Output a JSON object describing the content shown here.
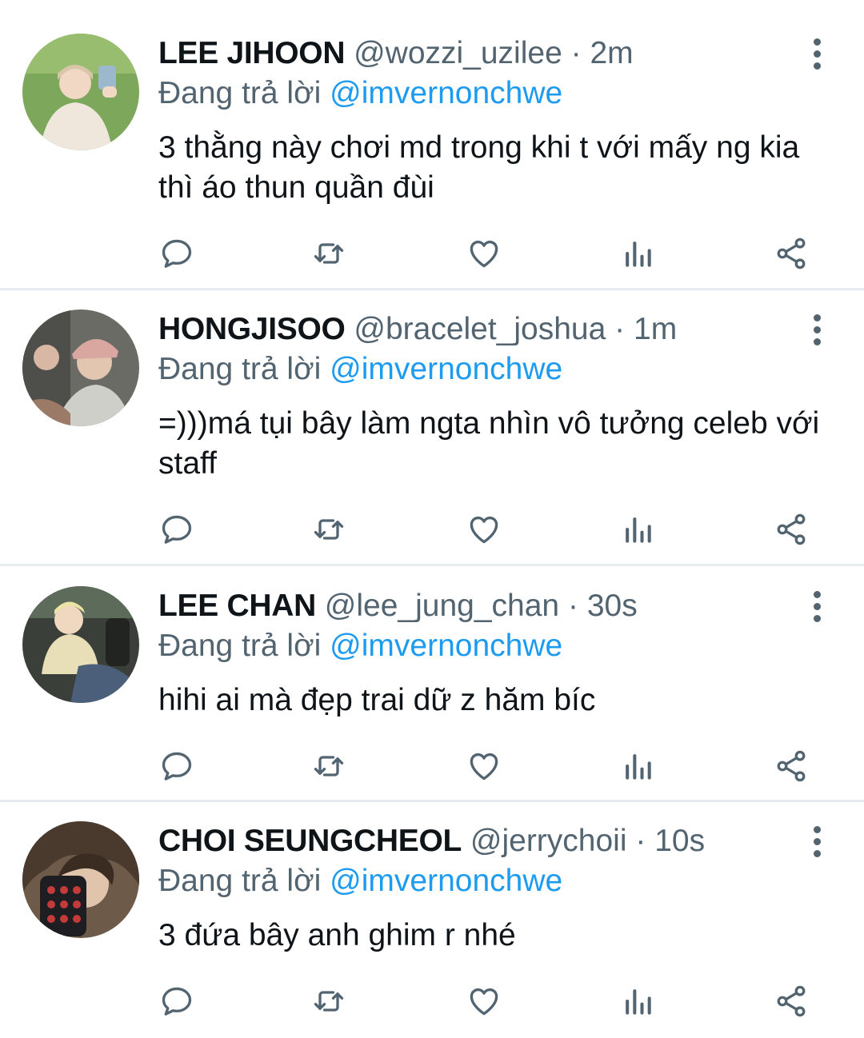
{
  "tweets": [
    {
      "name": "LEE JIHOON",
      "handle": "@wozzi_uzilee",
      "separator": "·",
      "time": "2m",
      "replying_prefix": "Đang trả lời",
      "replying_to": "@imvernonchwe",
      "text": "3 thằng này chơi md trong khi t với mấy ng kia thì áo thun quần đùi",
      "avatar_colors": [
        "#7da85c",
        "#efe6dc"
      ]
    },
    {
      "name": "HONGJISOO",
      "handle": "@bracelet_joshua",
      "separator": "·",
      "time": "1m",
      "replying_prefix": "Đang trả lời",
      "replying_to": "@imvernonchwe",
      "text": "=)))má tụi bây làm ngta nhìn vô tưởng celeb với staff",
      "avatar_colors": [
        "#6b6b66",
        "#d9a7a0"
      ]
    },
    {
      "name": "LEE CHAN",
      "handle": "@lee_jung_chan",
      "separator": "·",
      "time": "30s",
      "replying_prefix": "Đang trả lời",
      "replying_to": "@imvernonchwe",
      "text": "hihi ai mà đẹp trai dữ z hăm bíc",
      "avatar_colors": [
        "#3a3f3a",
        "#e8dfb8"
      ]
    },
    {
      "name": "CHOI SEUNGCHEOL",
      "handle": "@jerrychoii",
      "separator": "·",
      "time": "10s",
      "replying_prefix": "Đang trả lời",
      "replying_to": "@imvernonchwe",
      "text": "3 đứa bây anh ghim r nhé",
      "avatar_colors": [
        "#4a3a2e",
        "#c43a3a"
      ]
    }
  ],
  "actions": [
    "reply-icon",
    "retweet-icon",
    "like-icon",
    "analytics-icon",
    "share-icon"
  ],
  "colors": {
    "text": "#0f1419",
    "secondary": "#536471",
    "mention": "#1d9bf0",
    "divider": "#e6ecf0"
  }
}
